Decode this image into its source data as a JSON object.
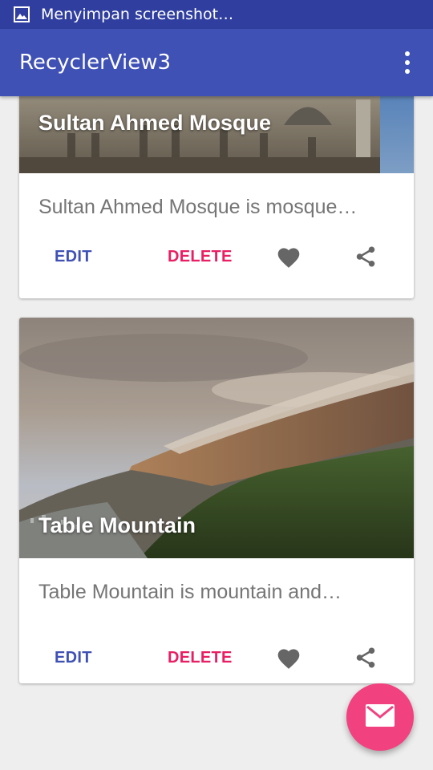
{
  "status_bar": {
    "icon": "image-icon",
    "text": "Menyimpan screenshot…"
  },
  "app_bar": {
    "title": "RecyclerView3",
    "menu_icon": "more-vert-icon"
  },
  "cards": [
    {
      "title": "Sultan Ahmed Mosque",
      "description": "Sultan Ahmed Mosque is mosque…",
      "edit_label": "EDIT",
      "delete_label": "DELETE",
      "favorite_icon": "heart-icon",
      "share_icon": "share-icon"
    },
    {
      "title": "Table Mountain",
      "description": "Table Mountain is mountain and…",
      "edit_label": "EDIT",
      "delete_label": "DELETE",
      "favorite_icon": "heart-icon",
      "share_icon": "share-icon"
    }
  ],
  "fab": {
    "icon": "email-icon"
  },
  "colors": {
    "primary": "#3f51b5",
    "primary_dark": "#303f9f",
    "accent": "#e91e63",
    "fab": "#f2417f",
    "background": "#eeeeee",
    "secondary_text": "#757575",
    "icon_gray": "#666666"
  }
}
